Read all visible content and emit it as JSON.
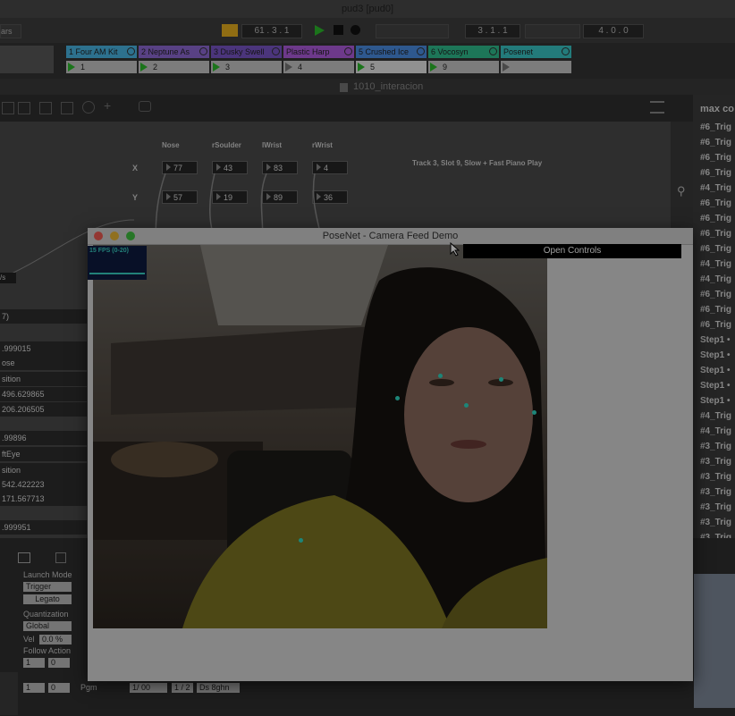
{
  "title_bar": {
    "title": "pud3  [pud0]"
  },
  "transport": {
    "left_label": "ars",
    "position": "61 . 3 . 1",
    "loop_start": "3 . 1 . 1",
    "loop_length": "4 . 0 . 0"
  },
  "tracks": [
    {
      "name": "1 Four AM Kit",
      "color": "#49b7e6",
      "slot": "1",
      "playing": true
    },
    {
      "name": "2 Neptune As",
      "color": "#8f6ad6",
      "slot": "2",
      "playing": true
    },
    {
      "name": "3 Dusky Swell",
      "color": "#7a56c8",
      "slot": "3",
      "playing": true
    },
    {
      "name": "Plastic Harp",
      "color": "#b05ce0",
      "slot": "4",
      "playing": false
    },
    {
      "name": "5 Crushed Ice",
      "color": "#4b8fe6",
      "slot": "5",
      "playing": true
    },
    {
      "name": "6 Vocosyn",
      "color": "#2fbf8f",
      "slot": "9",
      "playing": true
    },
    {
      "name": "Posenet",
      "color": "#39c7c7",
      "slot": "",
      "playing": false
    }
  ],
  "patcher": {
    "file": "1010_interacion",
    "columns": [
      "Nose",
      "rSoulder",
      "lWrist",
      "rWrist"
    ],
    "row_x": "X",
    "row_y": "Y",
    "x_values": [
      "77",
      "43",
      "83",
      "4"
    ],
    "y_values": [
      "57",
      "19",
      "89",
      "36"
    ],
    "comment": "Track 3, Slot 9, Slow + Fast Piano Play",
    "inlet_label": "/s"
  },
  "left_values": [
    "7)",
    ".999015",
    "ose",
    "sition",
    "496.629865",
    "206.206505",
    ".99896",
    "ftEye",
    "sition",
    "542.422223",
    "171.567713",
    ".999951"
  ],
  "console": {
    "header": "max co",
    "lines": [
      "#6_Trig",
      "#6_Trig",
      "#6_Trig",
      "#6_Trig",
      "#4_Trig",
      "#6_Trig",
      "#6_Trig",
      "#6_Trig",
      "#6_Trig",
      "#4_Trig",
      "#4_Trig",
      "#6_Trig",
      "#6_Trig",
      "#6_Trig",
      "Step1 •",
      "Step1 •",
      "Step1 •",
      "Step1 •",
      "Step1 •",
      "#4_Trig",
      "#4_Trig",
      "#3_Trig",
      "#3_Trig",
      "#3_Trig",
      "#3_Trig",
      "#3_Trig",
      "#3_Trig",
      "#3_Trig"
    ]
  },
  "clip_panel": {
    "launch_mode_label": "Launch Mode",
    "launch_mode_value": "Trigger",
    "legato": "Legato",
    "quantization_label": "Quantization",
    "quantization_value": "Global",
    "vel_label": "Vel",
    "vel_value": "0.0 %",
    "follow_action_label": "Follow Action",
    "follow_a": "1",
    "follow_b": "0",
    "bottom_a": "1",
    "bottom_b": "0",
    "pgm": "Pgm",
    "scale": "1/ 00",
    "range": "1 / 2",
    "signature": "Ds 8ghn"
  },
  "posenet": {
    "title": "PoseNet - Camera Feed Demo",
    "fps": "15 FPS (0-20)",
    "open_controls": "Open Controls"
  }
}
